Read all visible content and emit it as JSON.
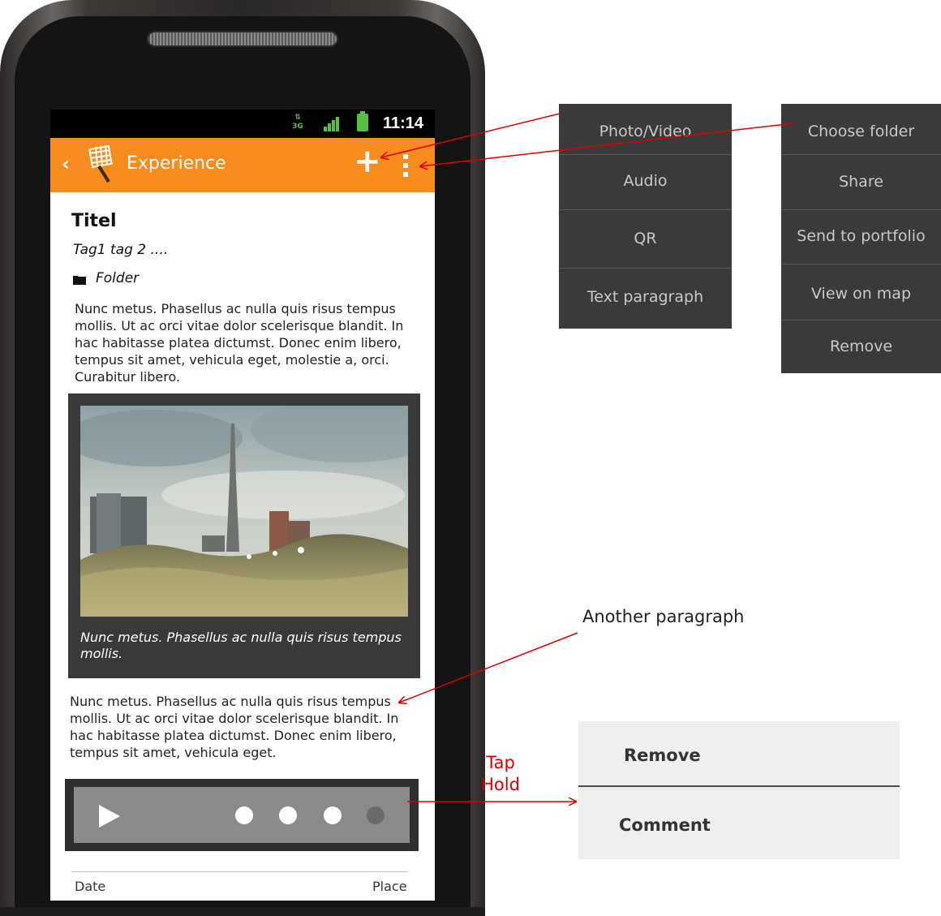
{
  "status_bar": {
    "network": "3G",
    "time": "11:14"
  },
  "action_bar": {
    "back_glyph": "‹",
    "title": "Experience",
    "add_glyph": "+"
  },
  "content": {
    "title": "Titel",
    "tags": "Tag1 tag 2 ....",
    "folder": "Folder",
    "paragraph_1": "Nunc metus. Phasellus ac nulla quis risus tempus mollis. Ut ac orci vitae dolor scelerisque blandit. In hac habitasse platea dictumst. Donec enim libero, tempus sit amet, vehicula eget, molestie a, orci. Curabitur libero.",
    "photo_caption": "Nunc metus. Phasellus ac nulla quis risus tempus mollis.",
    "paragraph_2": "Nunc metus. Phasellus ac nulla quis risus tempus mollis. Ut ac orci vitae dolor scelerisque blandit. In hac habitasse platea dictumst. Donec enim libero, tempus sit amet, vehicula eget.",
    "audio_player": {
      "dots": 4,
      "active_dots": 3
    },
    "footer": {
      "date": "Date",
      "place": "Place"
    }
  },
  "add_menu": {
    "items": [
      "Photo/Video",
      "Audio",
      "QR",
      "Text paragraph"
    ]
  },
  "overflow_menu": {
    "items": [
      "Choose folder",
      "Share",
      "Send to portfolio",
      "View on map",
      "Remove"
    ]
  },
  "context_menu": {
    "items": [
      "Remove",
      "Comment"
    ]
  },
  "annotations": {
    "another_paragraph": "Another paragraph",
    "tap": "Tap",
    "hold": "Hold"
  },
  "colors": {
    "action_bar": "#f68b1e",
    "annotation_arrow": "#dd0000",
    "status_icons": "#54c046",
    "menu_bg": "#3a3a3a"
  },
  "icons": {
    "back": "chevron-left-icon",
    "logo": "net-logo-icon",
    "add": "plus-icon",
    "overflow": "overflow-menu-icon",
    "folder": "folder-icon",
    "play": "play-icon"
  }
}
